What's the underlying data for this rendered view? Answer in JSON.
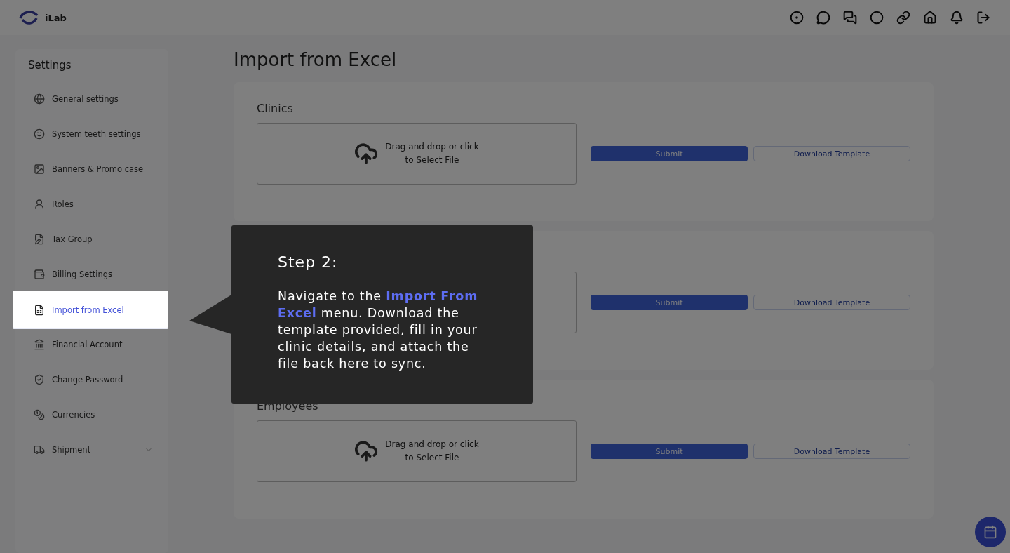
{
  "header": {
    "brand": "iLab"
  },
  "sidebar": {
    "title": "Settings",
    "items": [
      {
        "label": "General settings",
        "highlighted": false,
        "expandable": false
      },
      {
        "label": "System teeth settings",
        "highlighted": false,
        "expandable": false
      },
      {
        "label": "Banners & Promo case",
        "highlighted": false,
        "expandable": false
      },
      {
        "label": "Roles",
        "highlighted": false,
        "expandable": false
      },
      {
        "label": "Tax Group",
        "highlighted": false,
        "expandable": false
      },
      {
        "label": "Billing Settings",
        "highlighted": false,
        "expandable": false
      },
      {
        "label": "Import from Excel",
        "highlighted": true,
        "expandable": false
      },
      {
        "label": "Financial Account",
        "highlighted": false,
        "expandable": false
      },
      {
        "label": "Change Password",
        "highlighted": false,
        "expandable": false
      },
      {
        "label": "Currencies",
        "highlighted": false,
        "expandable": false
      },
      {
        "label": "Shipment",
        "highlighted": false,
        "expandable": true
      }
    ]
  },
  "page": {
    "title": "Import from Excel"
  },
  "sections": [
    {
      "title": "Clinics",
      "dropzone": [
        "Drag and drop or click",
        "to Select File"
      ],
      "submit": "Submit",
      "download": "Download Template"
    },
    {
      "submit": "Submit",
      "download": "Download Template"
    },
    {
      "title": "Employees",
      "dropzone": [
        "Drag and drop or click",
        "to Select File"
      ],
      "submit": "Submit",
      "download": "Download Template"
    }
  ],
  "tour": {
    "title": "Step 2:",
    "body": "Navigate to the **Import From Excel** menu. Download the template provided, fill in your clinic details, and attach the file back here to sync."
  }
}
